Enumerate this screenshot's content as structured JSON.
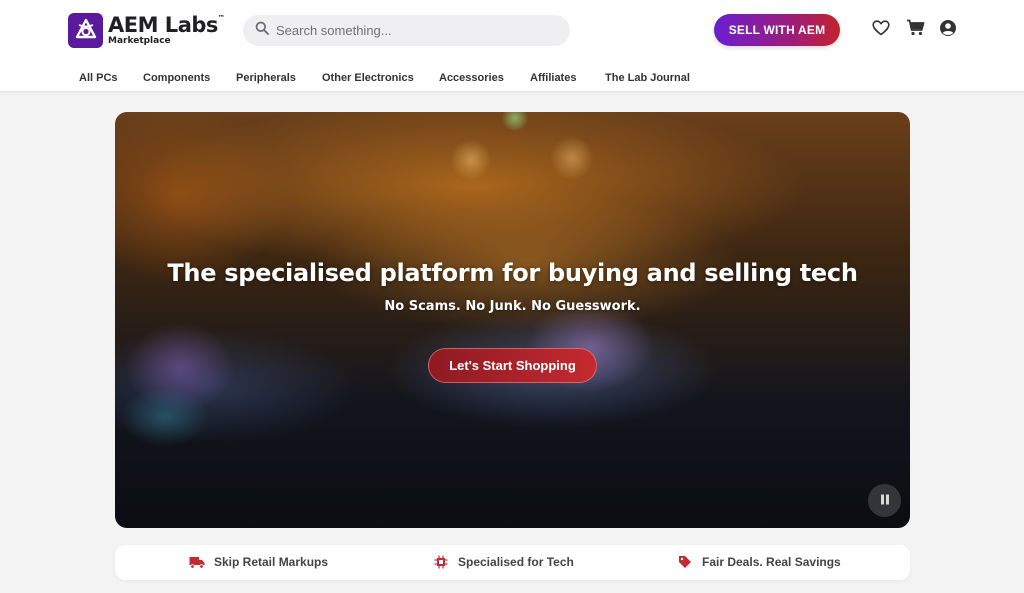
{
  "brand": {
    "name": "AEM Labs",
    "trademark": "™",
    "subtitle": "Marketplace",
    "color": "#5a1a9c"
  },
  "search": {
    "placeholder": "Search something..."
  },
  "header": {
    "sell_label": "SELL WITH AEM",
    "icons": [
      "heart-icon",
      "cart-icon",
      "account-icon"
    ]
  },
  "nav": {
    "items": [
      {
        "label": "All PCs"
      },
      {
        "label": "Components"
      },
      {
        "label": "Peripherals"
      },
      {
        "label": "Other Electronics"
      },
      {
        "label": "Accessories"
      },
      {
        "label": "Affiliates"
      },
      {
        "label": "The Lab Journal"
      }
    ]
  },
  "hero": {
    "title": "The specialised platform for buying and selling tech",
    "subtitle": "No Scams. No Junk. No Guesswork.",
    "cta_label": "Let's Start Shopping",
    "accent": "#c42a30"
  },
  "features": [
    {
      "label": "Skip Retail Markups",
      "icon": "truck-icon"
    },
    {
      "label": "Specialised for Tech",
      "icon": "chip-icon"
    },
    {
      "label": "Fair Deals. Real Savings",
      "icon": "tag-icon"
    }
  ]
}
